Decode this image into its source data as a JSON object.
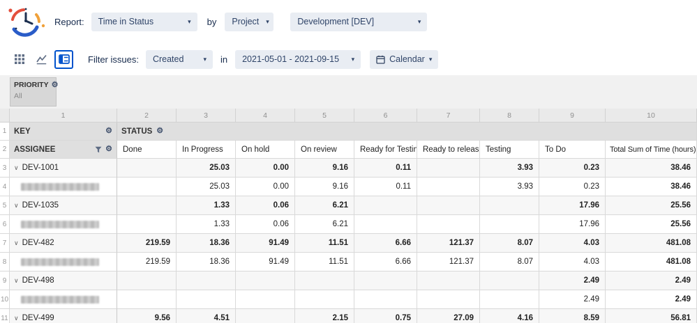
{
  "colors": {
    "accent_blue": "#0052cc",
    "dropdown_bg": "#e9edf3",
    "text_navy": "#172b4d",
    "header_gray": "#dfdfdf",
    "band_gray": "#f1f1f1"
  },
  "topbar": {
    "report_label": "Report:",
    "report_dropdown": "Time in Status",
    "by_label": "by",
    "scope_dropdown": "Project",
    "project_dropdown": "Development [DEV]"
  },
  "toolbar": {
    "filter_label": "Filter issues:",
    "filter_dropdown": "Created",
    "in_label": "in",
    "date_range_dropdown": "2021-05-01 - 2021-09-15",
    "calendar_button": "Calendar"
  },
  "pivot": {
    "priority": {
      "label": "PRIORITY",
      "value": "All"
    },
    "column_numbers": [
      "1",
      "2",
      "3",
      "4",
      "5",
      "6",
      "7",
      "8",
      "9",
      "10"
    ],
    "header_row_numbers": [
      "1",
      "2"
    ],
    "corner_headers": {
      "key": "KEY",
      "status": "STATUS",
      "assignee": "ASSIGNEE"
    },
    "status_columns": [
      "Done",
      "In Progress",
      "On hold",
      "On review",
      "Ready for Testing",
      "Ready to release",
      "Testing",
      "To Do",
      "Total Sum of Time (hours)"
    ],
    "rows": [
      {
        "num": "3",
        "type": "key",
        "label": "DEV-1001",
        "values": [
          "",
          "25.03",
          "0.00",
          "9.16",
          "0.11",
          "",
          "3.93",
          "0.23",
          "38.46"
        ]
      },
      {
        "num": "4",
        "type": "assignee",
        "redacted": true,
        "values": [
          "",
          "25.03",
          "0.00",
          "9.16",
          "0.11",
          "",
          "3.93",
          "0.23",
          "38.46"
        ]
      },
      {
        "num": "5",
        "type": "key",
        "label": "DEV-1035",
        "values": [
          "",
          "1.33",
          "0.06",
          "6.21",
          "",
          "",
          "",
          "17.96",
          "25.56"
        ]
      },
      {
        "num": "6",
        "type": "assignee",
        "redacted": true,
        "values": [
          "",
          "1.33",
          "0.06",
          "6.21",
          "",
          "",
          "",
          "17.96",
          "25.56"
        ]
      },
      {
        "num": "7",
        "type": "key",
        "label": "DEV-482",
        "values": [
          "219.59",
          "18.36",
          "91.49",
          "11.51",
          "6.66",
          "121.37",
          "8.07",
          "4.03",
          "481.08"
        ]
      },
      {
        "num": "8",
        "type": "assignee",
        "redacted": true,
        "values": [
          "219.59",
          "18.36",
          "91.49",
          "11.51",
          "6.66",
          "121.37",
          "8.07",
          "4.03",
          "481.08"
        ]
      },
      {
        "num": "9",
        "type": "key",
        "label": "DEV-498",
        "values": [
          "",
          "",
          "",
          "",
          "",
          "",
          "",
          "2.49",
          "2.49"
        ]
      },
      {
        "num": "10",
        "type": "assignee",
        "redacted": true,
        "values": [
          "",
          "",
          "",
          "",
          "",
          "",
          "",
          "2.49",
          "2.49"
        ]
      },
      {
        "num": "11",
        "type": "key",
        "label": "DEV-499",
        "values": [
          "9.56",
          "4.51",
          "",
          "2.15",
          "0.75",
          "27.09",
          "4.16",
          "8.59",
          "56.81"
        ]
      }
    ]
  }
}
